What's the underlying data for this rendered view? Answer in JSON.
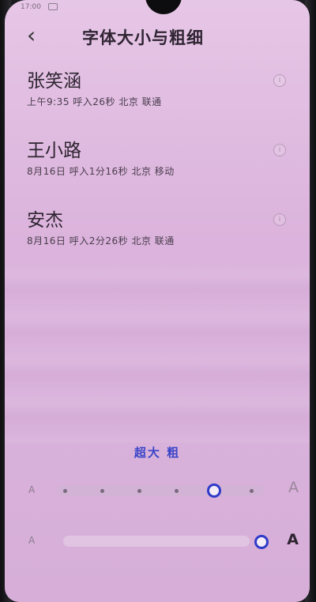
{
  "status_bar": {
    "time": "17:00"
  },
  "header": {
    "back_icon": "‹",
    "title": "字体大小与粗细"
  },
  "contacts": [
    {
      "name": "张笑涵",
      "meta": "上午9:35  呼入26秒  北京  联通"
    },
    {
      "name": "王小路",
      "meta": "8月16日  呼入1分16秒  北京  移动"
    },
    {
      "name": "安杰",
      "meta": "8月16日  呼入2分26秒  北京  联通"
    }
  ],
  "preview": {
    "label": "超大 粗"
  },
  "size_slider": {
    "min_label": "A",
    "max_label": "A",
    "stops": 6,
    "selected_index": 4
  },
  "weight_slider": {
    "min_label": "A",
    "max_label": "A",
    "value": 1.0
  },
  "colors": {
    "accent": "#2f3bc8",
    "background": "#dbb3dc"
  }
}
